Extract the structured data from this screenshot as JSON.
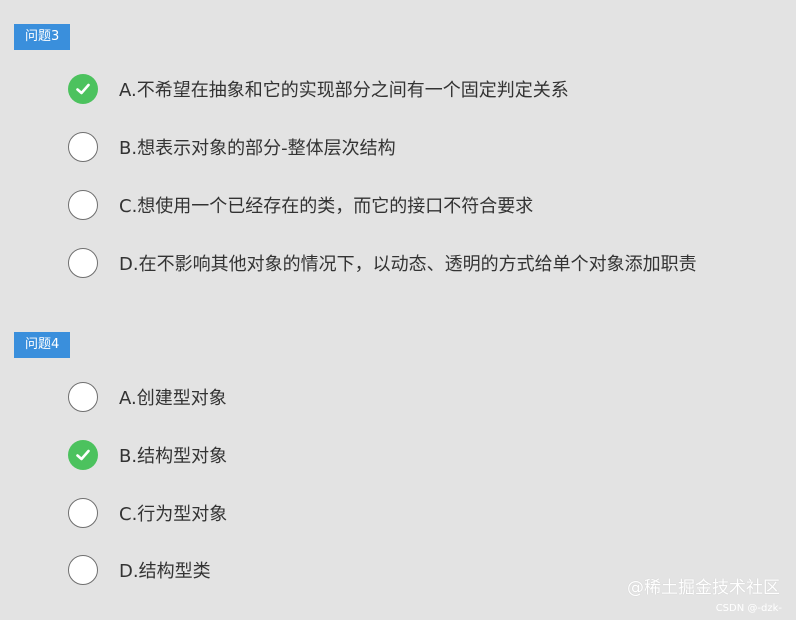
{
  "questions": [
    {
      "label": "问题3",
      "options": [
        {
          "text": "A.不希望在抽象和它的实现部分之间有一个固定判定关系",
          "selected": true
        },
        {
          "text": "B.想表示对象的部分-整体层次结构",
          "selected": false
        },
        {
          "text": "C.想使用一个已经存在的类，而它的接口不符合要求",
          "selected": false
        },
        {
          "text": "D.在不影响其他对象的情况下，以动态、透明的方式给单个对象添加职责",
          "selected": false
        }
      ]
    },
    {
      "label": "问题4",
      "options": [
        {
          "text": "A.创建型对象",
          "selected": false
        },
        {
          "text": "B.结构型对象",
          "selected": true
        },
        {
          "text": "C.行为型对象",
          "selected": false
        },
        {
          "text": "D.结构型类",
          "selected": false
        }
      ]
    }
  ],
  "watermark": {
    "main": "@稀土掘金技术社区",
    "sub": "CSDN @-dzk-"
  },
  "icons": {
    "selected": "check-icon",
    "unselected": "radio-empty-icon"
  },
  "colors": {
    "label_bg": "#3a8fdc",
    "check_bg": "#4cc25e",
    "page_bg": "#e3e3e3"
  }
}
